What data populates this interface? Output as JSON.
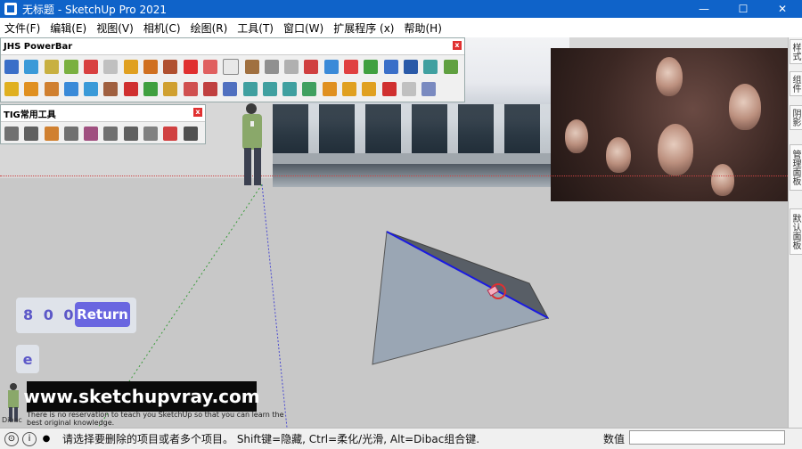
{
  "window": {
    "title": "无标题 - SketchUp Pro 2021",
    "minimize": "—",
    "maximize": "☐",
    "close": "✕"
  },
  "menu": [
    "文件(F)",
    "编辑(E)",
    "视图(V)",
    "相机(C)",
    "绘图(R)",
    "工具(T)",
    "窗口(W)",
    "扩展程序 (x)",
    "帮助(H)"
  ],
  "toolbars": {
    "powerbar_title": "JHS PowerBar",
    "tig_title": "TIG常用工具",
    "close_glyph": "x"
  },
  "side_tabs": [
    "样式",
    "组件",
    "阴影",
    "管理面板",
    "默认面板"
  ],
  "overlay": {
    "digits": "8 0 0",
    "return_label": "Return",
    "key": "e",
    "watermark": "www.sketchupvray.com",
    "caption": "There is no reservation to teach you SketchUp so that you can learn the best original knowledge.",
    "dibac": "Dibac"
  },
  "status": {
    "message": "请选择要删除的项目或者多个项目。 Shift键=隐藏, Ctrl=柔化/光滑, Alt=Dibac组合键.",
    "measure_label": "数值",
    "measure_value": ""
  },
  "colors": {
    "titlebar": "#0f63c9",
    "edge_blue": "#1a1ae0",
    "face": "#9aa6b4"
  }
}
